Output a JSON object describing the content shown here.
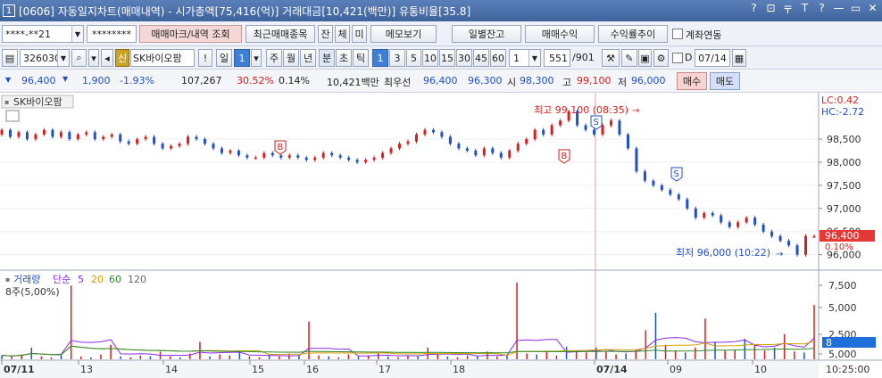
{
  "window": {
    "number": "1",
    "title": "[0606] 자동일지차트(매매내역) - 시가총액[75,416(억)] 거래대금[10,421(백만)] 유통비율[35.8]",
    "controls": [
      "?",
      "⊡",
      "〒",
      "T",
      "?",
      "—",
      "▭",
      "✕"
    ]
  },
  "toolbar1": {
    "account": "****-**21",
    "password": "********",
    "trade_mark_btn": "매매마크/내역 조회",
    "recent_btn": "최근매매종목",
    "tab_jan": "잔",
    "tab_che": "체",
    "tab_mi": "미",
    "memo_btn": "메모보기",
    "daily_balance_btn": "일별잔고",
    "trade_profit_btn": "매매수익",
    "return_trend_btn": "수익률추이",
    "account_link_label": "계좌연동"
  },
  "toolbar2": {
    "code": "326030",
    "shin": "신",
    "stock_name": "SK바이오팜",
    "excl": "!",
    "period_day": "일",
    "period_num": "1",
    "periods": [
      "주",
      "월",
      "년",
      "분",
      "초",
      "틱"
    ],
    "active_period": "분",
    "minutes": [
      "1",
      "3",
      "5",
      "10",
      "15",
      "30",
      "45",
      "60"
    ],
    "active_minute": "1",
    "custom_num": "1",
    "count": "551",
    "total": "/901",
    "d_label": "D",
    "date": "07/14"
  },
  "quote": {
    "price": "96,400",
    "change": "1,900",
    "change_pct": "-1.93%",
    "volume": "107,267",
    "turnover_pct": "30.52%",
    "vol_ratio": "0.14%",
    "value": "10,421백만",
    "best_label": "최우선",
    "ask": "96,400",
    "bid": "96,300",
    "open_label": "시",
    "open": "98,300",
    "high_label": "고",
    "high": "99,100",
    "low_label": "저",
    "low": "96,000",
    "buy_btn": "매수",
    "sell_btn": "매도"
  },
  "chart_data": [
    {
      "type": "candlestick",
      "title": "SK바이오팜",
      "y_ticks": [
        "98,500",
        "98,000",
        "97,500",
        "97,000",
        "96,500",
        "96,000"
      ],
      "ylim": [
        95800,
        99350
      ],
      "x_ticks": [
        "07/11",
        "13",
        "14",
        "15",
        "16",
        "17",
        "18",
        "07/14",
        "09",
        "10",
        "10:25:00"
      ],
      "lc": "LC:0.42",
      "hc": "HC:-2.72",
      "current_price": "96,400",
      "current_pct": "0.10%",
      "high_annotation": "최고 99,100 (08:35)",
      "low_annotation": "최저 96,000 (10:22)",
      "high": 99100,
      "low": 96000,
      "markers": [
        {
          "label": "B",
          "kind": "buy"
        },
        {
          "label": "B",
          "kind": "buy"
        },
        {
          "label": "S",
          "kind": "sell"
        },
        {
          "label": "S",
          "kind": "sell"
        }
      ],
      "price_path": [
        98600,
        98700,
        98550,
        98650,
        98500,
        98600,
        98700,
        98550,
        98650,
        98500,
        98600,
        98650,
        98500,
        98550,
        98600,
        98450,
        98400,
        98500,
        98550,
        98400,
        98300,
        98350,
        98400,
        98550,
        98500,
        98400,
        98300,
        98200,
        98250,
        98150,
        98100,
        98100,
        98200,
        98150,
        98100,
        98150,
        98100,
        98050,
        98100,
        98200,
        98150,
        98100,
        98050,
        98000,
        98050,
        98100,
        98200,
        98300,
        98400,
        98450,
        98600,
        98700,
        98650,
        98550,
        98400,
        98300,
        98250,
        98150,
        98300,
        98200,
        98100,
        98250,
        98400,
        98500,
        98700,
        98600,
        98800,
        98900,
        99100,
        98800,
        98700,
        98600,
        98800,
        98900,
        98600,
        98300,
        97800,
        97600,
        97500,
        97400,
        97300,
        97200,
        97000,
        96800,
        96900,
        96850,
        96700,
        96600,
        96700,
        96800,
        96650,
        96500,
        96400,
        96300,
        96200,
        96000,
        96400
      ]
    },
    {
      "type": "bar",
      "title": "거래량",
      "legend": {
        "simple": "단순",
        "ma": [
          {
            "name": "5",
            "color": "#8a2be2"
          },
          {
            "name": "20",
            "color": "#d4a000"
          },
          {
            "name": "60",
            "color": "#2a8a2a"
          },
          {
            "name": "120",
            "color": "#666666"
          }
        ]
      },
      "sub_label": "8주(5,00%)",
      "y_ticks": [
        "7,500",
        "5,000",
        "2,500",
        "5,000"
      ],
      "current_value": "8",
      "ylim": [
        0,
        8000
      ],
      "values": [
        400,
        300,
        500,
        1200,
        300,
        200,
        400,
        7600,
        300,
        200,
        500,
        1500,
        300,
        200,
        400,
        300,
        800,
        300,
        200,
        600,
        1800,
        300,
        500,
        400,
        700,
        300,
        200,
        400,
        300,
        600,
        400,
        3900,
        400,
        300,
        200,
        500,
        300,
        400,
        600,
        300,
        200,
        400,
        300,
        1200,
        500,
        300,
        200,
        400,
        300,
        800,
        300,
        400,
        7900,
        600,
        500,
        800,
        400,
        1300,
        900,
        700,
        1200,
        800,
        500,
        600,
        1000,
        3000,
        4800,
        1500,
        900,
        700,
        1200,
        4200,
        1800,
        900,
        1000,
        2100,
        1500,
        900,
        1200,
        2600,
        800,
        700,
        5600
      ]
    }
  ]
}
